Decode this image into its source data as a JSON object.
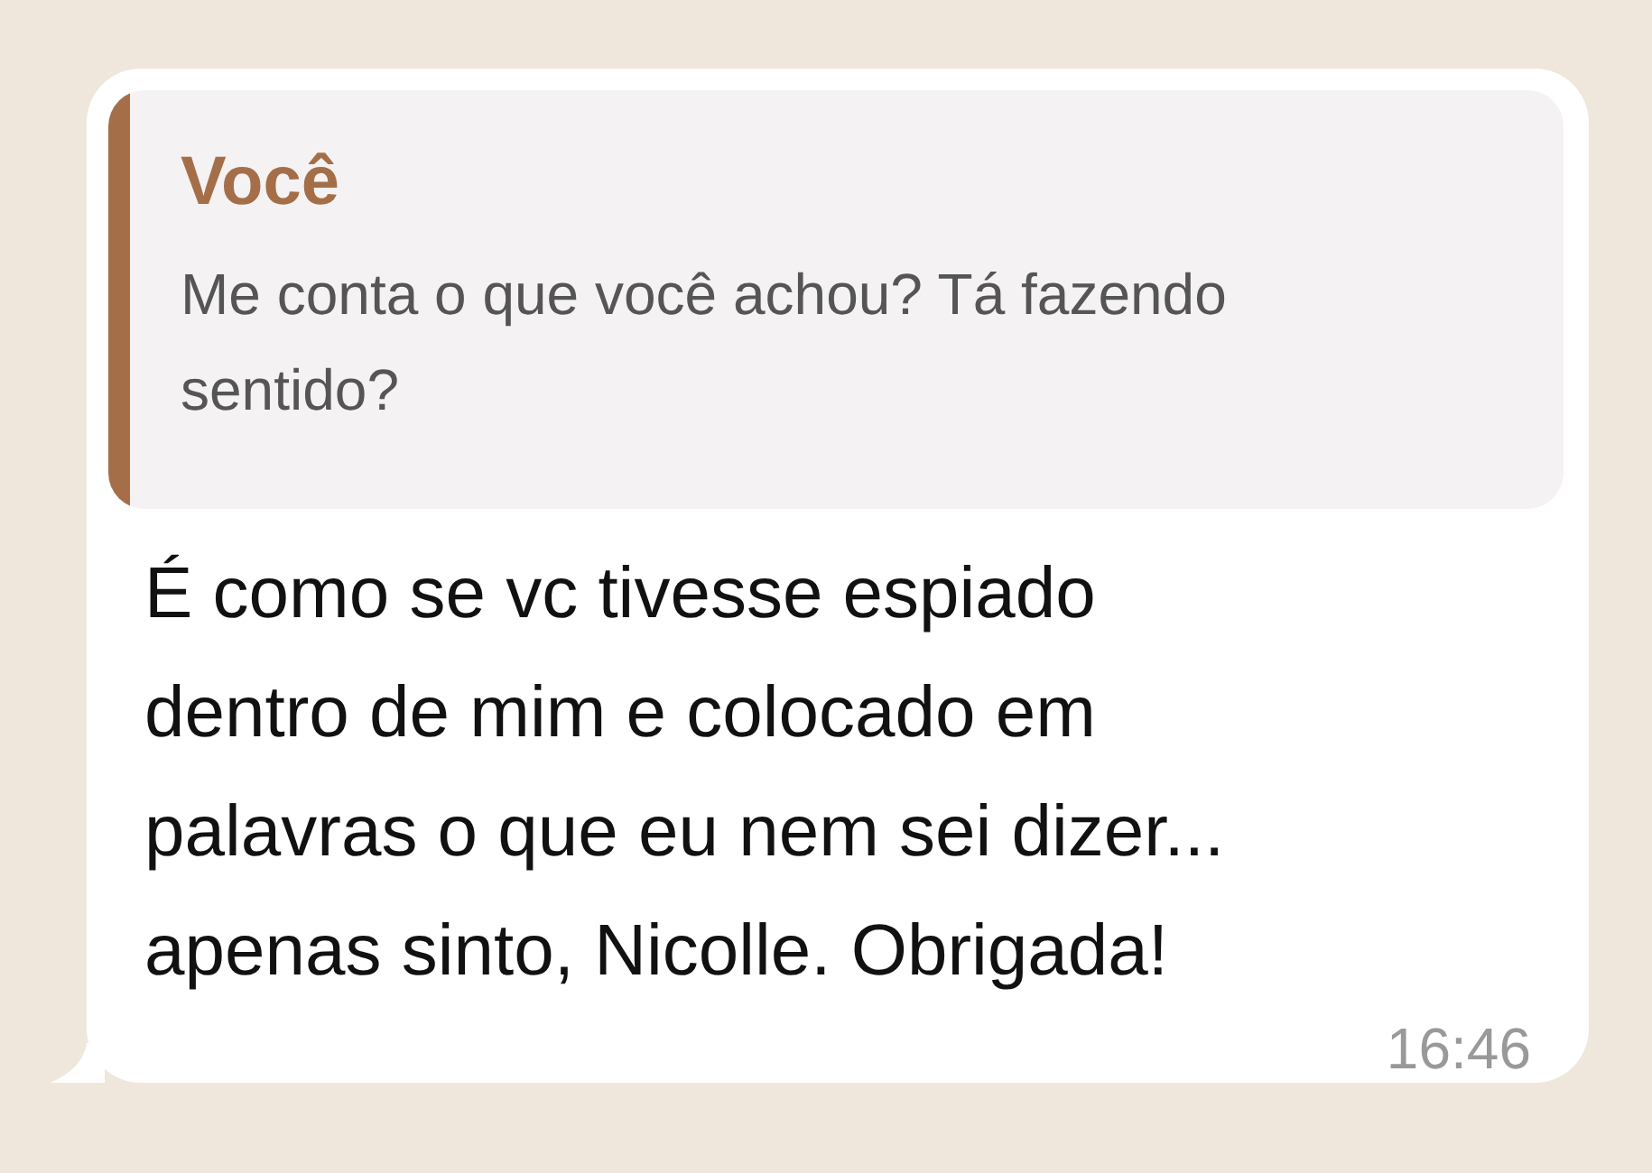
{
  "quoted_message": {
    "author": "Você",
    "text": "Me conta o que você achou? Tá fazendo\nsentido?"
  },
  "message": {
    "text": "É como se vc tivesse espiado\ndentro de mim e colocado em\npalavras o que eu nem sei dizer...\napenas sinto, Nicolle. Obrigada!",
    "time": "16:46"
  }
}
